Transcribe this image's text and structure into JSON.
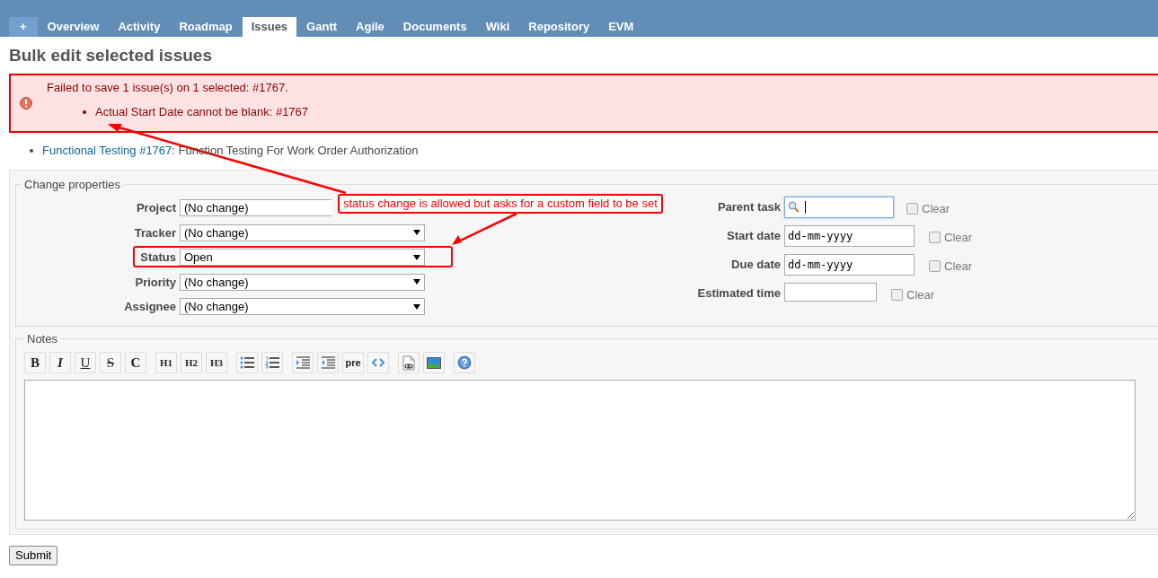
{
  "tabs": [
    {
      "label": "+",
      "kind": "new",
      "selected": false
    },
    {
      "label": "Overview",
      "kind": "tab",
      "selected": false
    },
    {
      "label": "Activity",
      "kind": "tab",
      "selected": false
    },
    {
      "label": "Roadmap",
      "kind": "tab",
      "selected": false
    },
    {
      "label": "Issues",
      "kind": "tab",
      "selected": true
    },
    {
      "label": "Gantt",
      "kind": "tab",
      "selected": false
    },
    {
      "label": "Agile",
      "kind": "tab",
      "selected": false
    },
    {
      "label": "Documents",
      "kind": "tab",
      "selected": false
    },
    {
      "label": "Wiki",
      "kind": "tab",
      "selected": false
    },
    {
      "label": "Repository",
      "kind": "tab",
      "selected": false
    },
    {
      "label": "EVM",
      "kind": "tab",
      "selected": false
    }
  ],
  "title": "Bulk edit selected issues",
  "error": {
    "message": "Failed to save 1 issue(s) on 1 selected: #1767.",
    "details": [
      "Actual Start Date cannot be blank: #1767"
    ]
  },
  "issues": [
    {
      "link": "Functional Testing #1767",
      "text": ": Function Testing For Work Order Authorization"
    }
  ],
  "properties": {
    "legend": "Change properties",
    "left": [
      {
        "label": "Project",
        "value": "(No change)",
        "partly_hidden": true
      },
      {
        "label": "Tracker",
        "value": "(No change)"
      },
      {
        "label": "Status",
        "value": "Open"
      },
      {
        "label": "Priority",
        "value": "(No change)"
      },
      {
        "label": "Assignee",
        "value": "(No change)"
      }
    ],
    "right": [
      {
        "label": "Parent task",
        "kind": "search",
        "focused": true,
        "clear_label": "Clear",
        "clear_checked": false
      },
      {
        "label": "Start date",
        "kind": "date",
        "placeholder": "dd-mm-yyyy",
        "focused": false,
        "clear_label": "Clear",
        "clear_checked": false
      },
      {
        "label": "Due date",
        "kind": "date",
        "placeholder": "dd-mm-yyyy",
        "focused": false,
        "clear_label": "Clear",
        "clear_checked": false
      },
      {
        "label": "Estimated time",
        "kind": "text",
        "focused": false,
        "clear_label": "Clear",
        "clear_checked": false
      }
    ]
  },
  "notes": {
    "legend": "Notes",
    "toolbar": [
      [
        {
          "kind": "bold",
          "label": "B"
        },
        {
          "kind": "italic",
          "label": "I"
        },
        {
          "kind": "underline",
          "label": "U"
        },
        {
          "kind": "strike",
          "label": "S"
        },
        {
          "kind": "bold",
          "label": "C"
        }
      ],
      [
        {
          "kind": "heading",
          "label": "H1"
        },
        {
          "kind": "heading",
          "label": "H2"
        },
        {
          "kind": "heading",
          "label": "H3"
        }
      ],
      [
        {
          "kind": "bullets"
        },
        {
          "kind": "numbers"
        }
      ],
      [
        {
          "kind": "indent"
        },
        {
          "kind": "outdent"
        },
        {
          "kind": "pre",
          "label": "pre"
        },
        {
          "kind": "code"
        }
      ],
      [
        {
          "kind": "link"
        },
        {
          "kind": "image"
        }
      ],
      [
        {
          "kind": "help"
        }
      ]
    ]
  },
  "submit": "Submit",
  "annotation": {
    "text": "status change is allowed but asks for a custom field to be set"
  }
}
